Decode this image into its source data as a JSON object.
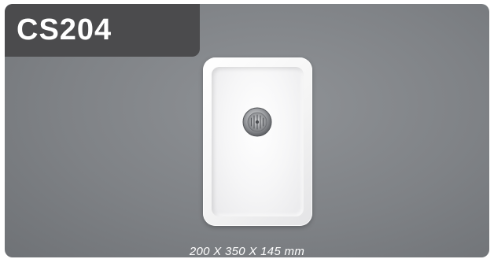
{
  "product": {
    "model": "CS204",
    "dimensions": "200 X 350 X 145 mm"
  },
  "colors": {
    "background": "#808387",
    "model_tab": "#4b4b4d",
    "sink": "#f4f4f4"
  },
  "image": {
    "subject": "sink-icon",
    "drain": "drain-icon"
  }
}
